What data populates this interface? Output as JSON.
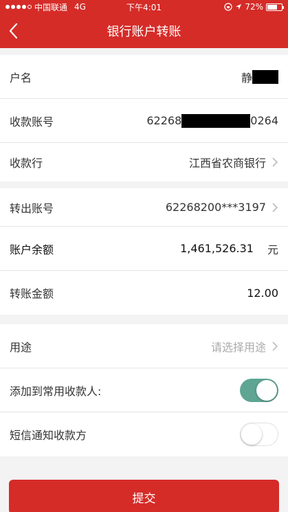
{
  "status_bar": {
    "carrier": "中国联通",
    "network": "4G",
    "time": "下午4:01",
    "battery": "72%",
    "battery_level": 0.72
  },
  "nav": {
    "title": "银行账户转账"
  },
  "rows": {
    "account_name": {
      "label": "户名",
      "value": "静"
    },
    "payee_account": {
      "label": "收款账号",
      "value_start": "62268",
      "value_end": "0264"
    },
    "payee_bank": {
      "label": "收款行",
      "value": "江西省农商银行"
    },
    "from_account": {
      "label": "转出账号",
      "value": "62268200***3197"
    },
    "balance": {
      "label": "账户余额",
      "value": "1,461,526.31",
      "unit": "元"
    },
    "amount": {
      "label": "转账金额",
      "value": "12.00"
    },
    "purpose": {
      "label": "用途",
      "placeholder": "请选择用途"
    },
    "add_contact": {
      "label": "添加到常用收款人:",
      "enabled": true
    },
    "sms_notify": {
      "label": "短信通知收款方",
      "enabled": false
    }
  },
  "submit": {
    "label": "提交"
  },
  "colors": {
    "brand_red": "#d52c28",
    "toggle_green": "#5ea593"
  }
}
